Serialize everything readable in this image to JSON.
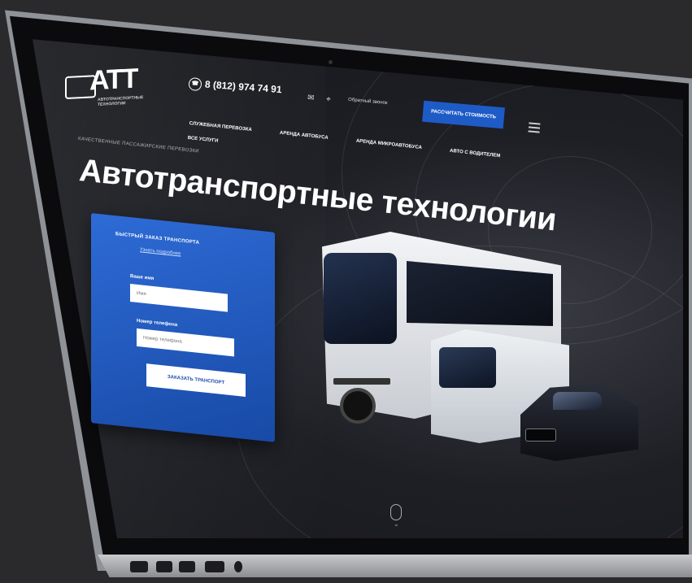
{
  "site": {
    "logo_text": "АТТ",
    "logo_sub": "АВТОТРАНСПОРТНЫЕ ТЕХНОЛОГИИ",
    "phone": "8 (812) 974 74 91",
    "callback_label": "Обратный звонок",
    "cta_label": "РАССЧИТАТЬ СТОИМОСТЬ",
    "nav": [
      {
        "label": "СЛУЖЕБНАЯ ПЕРЕВОЗКА"
      },
      {
        "label": "АРЕНДА АВТОБУСА"
      },
      {
        "label": "АРЕНДА МИКРОАВТОБУСА"
      },
      {
        "label": "АВТО С ВОДИТЕЛЕМ"
      },
      {
        "label": "ВСЕ УСЛУГИ"
      }
    ],
    "tagline": "КАЧЕСТВЕННЫЕ ПАССАЖИРСКИЕ ПЕРЕВОЗКИ",
    "headline": "Автотранспортные технологии"
  },
  "form": {
    "title": "БЫСТРЫЙ ЗАКАЗ ТРАНСПОРТА",
    "subtitle": "Узнать подробнее",
    "name_label": "Ваше имя",
    "name_placeholder": "Имя",
    "phone_label": "Номер телефона",
    "phone_placeholder": "Номер телефона",
    "submit_label": "ЗАКАЗАТЬ ТРАНСПОРТ"
  },
  "icons": {
    "mail": "mail-icon",
    "location": "location-pin-icon",
    "phone": "phone-icon",
    "menu": "hamburger-menu-icon",
    "scroll": "mouse-scroll-icon"
  },
  "colors": {
    "accent": "#1e5bc6",
    "background": "#1e1f25",
    "form_gradient_start": "#2e6bd6",
    "form_gradient_end": "#184aa6"
  }
}
